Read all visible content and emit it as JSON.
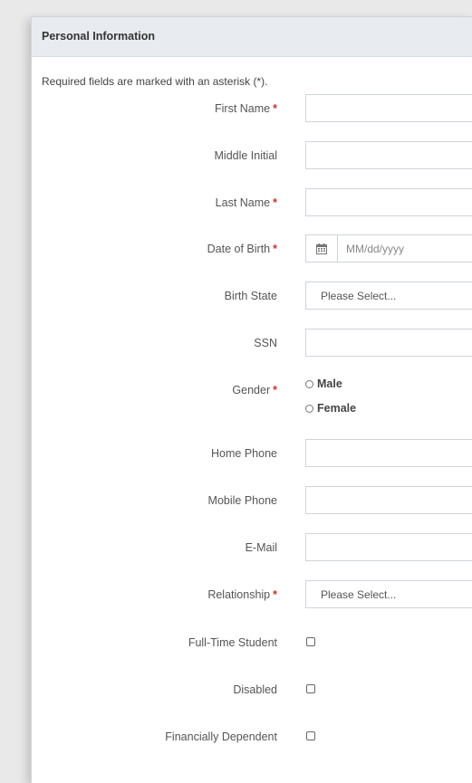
{
  "panel": {
    "title": "Personal Information",
    "required_note": "Required fields are marked with an asterisk (*)."
  },
  "fields": {
    "first_name": {
      "label": "First Name",
      "required": "*",
      "value": ""
    },
    "middle_initial": {
      "label": "Middle Initial",
      "value": ""
    },
    "last_name": {
      "label": "Last Name",
      "required": "*",
      "value": ""
    },
    "date_of_birth": {
      "label": "Date of Birth",
      "required": "*",
      "placeholder": "MM/dd/yyyy",
      "icon": "calendar-icon"
    },
    "birth_state": {
      "label": "Birth State",
      "selected": "Please Select..."
    },
    "ssn": {
      "label": "SSN",
      "value": ""
    },
    "gender": {
      "label": "Gender",
      "required": "*",
      "options": [
        "Male",
        "Female"
      ]
    },
    "home_phone": {
      "label": "Home Phone",
      "value": ""
    },
    "mobile_phone": {
      "label": "Mobile Phone",
      "value": ""
    },
    "email": {
      "label": "E-Mail",
      "value": ""
    },
    "relationship": {
      "label": "Relationship",
      "required": "*",
      "selected": "Please Select..."
    },
    "full_time_student": {
      "label": "Full-Time Student",
      "checked": false
    },
    "disabled": {
      "label": "Disabled",
      "checked": false
    },
    "financially_dependent": {
      "label": "Financially Dependent",
      "checked": false
    }
  },
  "colors": {
    "header_bg": "#e8ecf0",
    "required": "#d0302b",
    "border": "#cfd4d9"
  }
}
